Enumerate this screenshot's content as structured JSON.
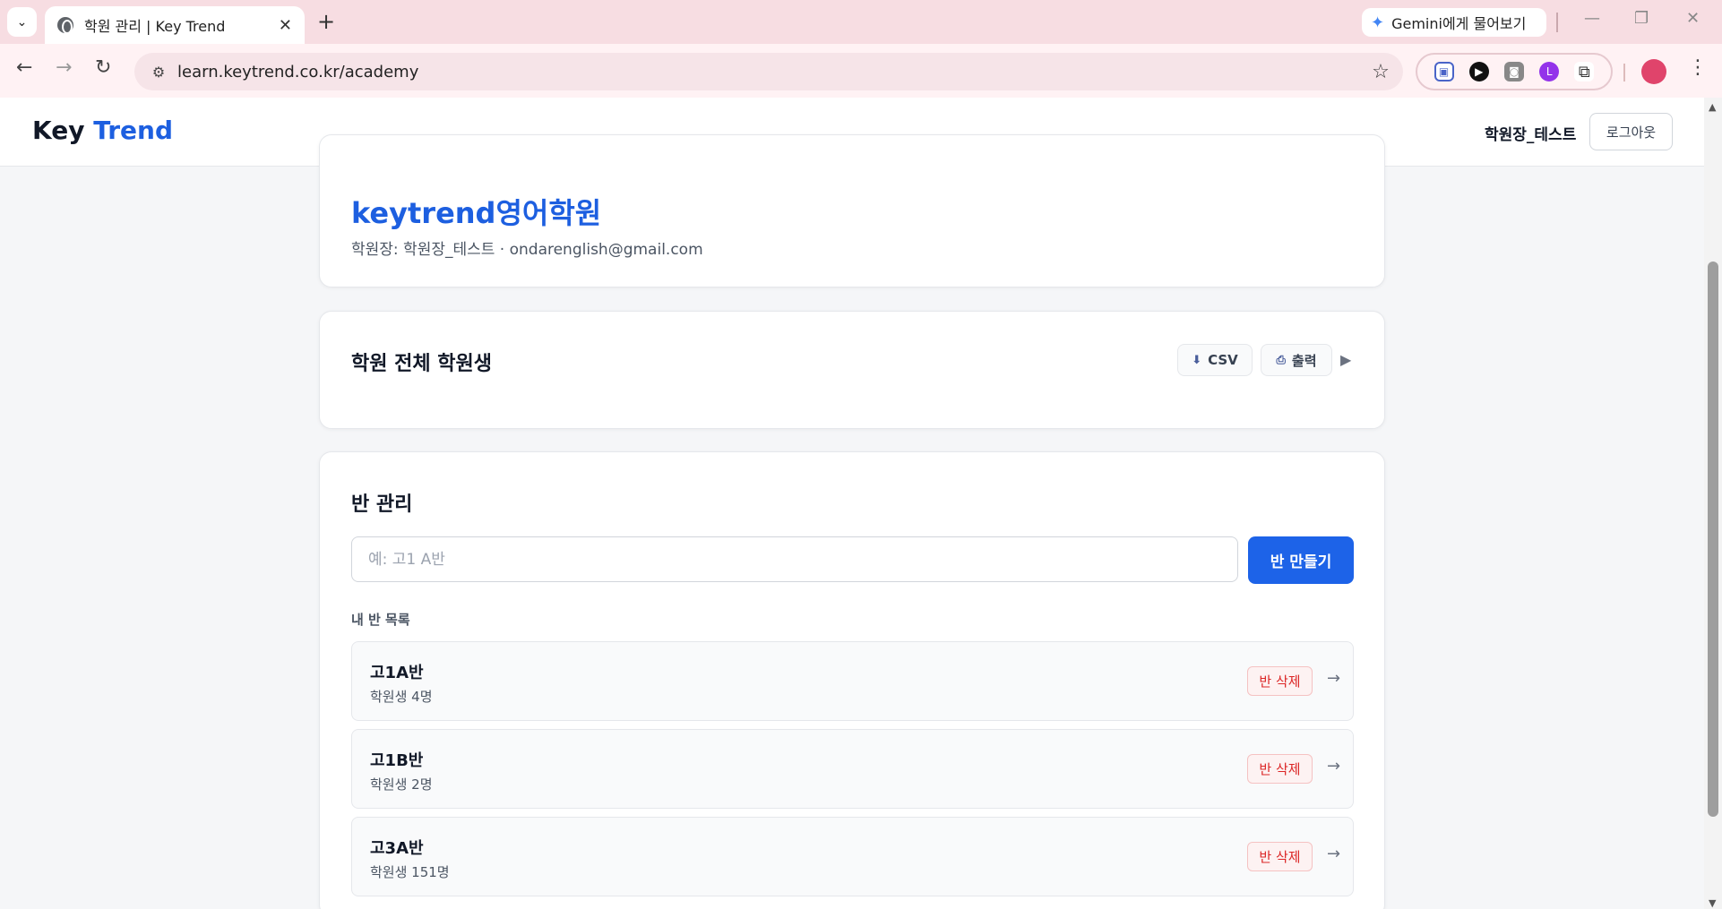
{
  "browser": {
    "tab_title": "학원 관리 | Key Trend",
    "url": "learn.keytrend.co.kr/academy",
    "gemini_label": "Gemini에게 물어보기"
  },
  "header": {
    "logo_main": "Key",
    "logo_accent": "Trend",
    "username": "학원장_테스트",
    "logout_label": "로그아웃"
  },
  "academy": {
    "name": "keytrend영어학원",
    "owner_line": "학원장: 학원장_테스트 · ondarenglish@gmail.com"
  },
  "students": {
    "title": "학원 전체 학원생",
    "csv_label": "CSV",
    "print_label": "출력"
  },
  "classes": {
    "title": "반 관리",
    "input_placeholder": "예: 고1 A반",
    "create_label": "반 만들기",
    "list_label": "내 반 목록",
    "delete_label": "반 삭제",
    "items": [
      {
        "name": "고1A반",
        "count": "학원생 4명"
      },
      {
        "name": "고1B반",
        "count": "학원생 2명"
      },
      {
        "name": "고3A반",
        "count": "학원생 151명"
      }
    ]
  }
}
